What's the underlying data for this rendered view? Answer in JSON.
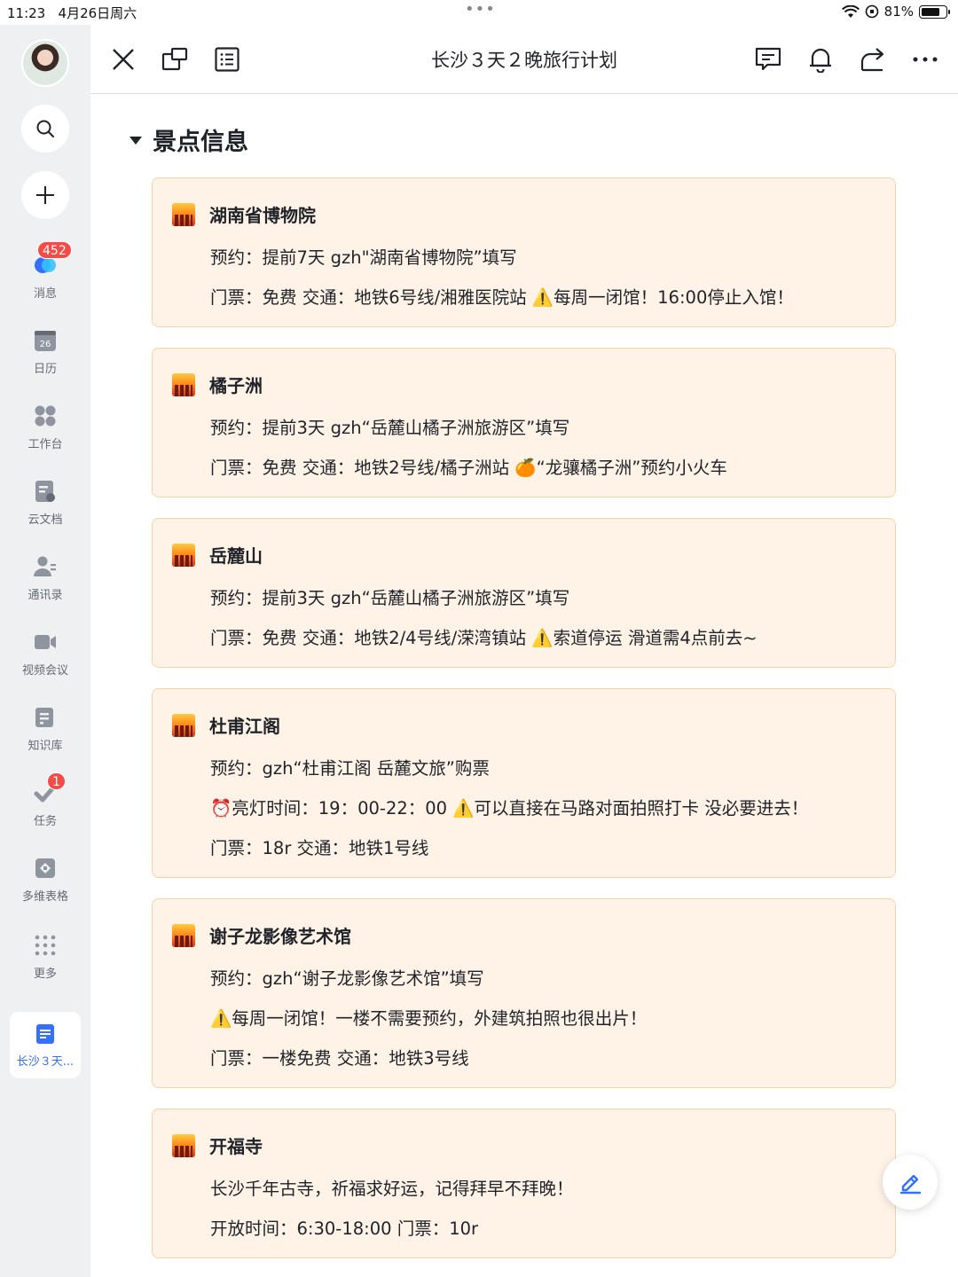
{
  "status_bar": {
    "time": "11:23",
    "date": "4月26日周六",
    "dots": "•••",
    "battery": "81%",
    "battery_level": 0.81
  },
  "sidebar": {
    "message_badge": "452",
    "task_badge": "1",
    "items": [
      {
        "label": "消息",
        "icon": "chat-bubble-icon"
      },
      {
        "label": "日历",
        "icon": "calendar-icon",
        "icon_text": "26"
      },
      {
        "label": "工作台",
        "icon": "grid-apps-icon"
      },
      {
        "label": "云文档",
        "icon": "cloud-doc-icon"
      },
      {
        "label": "通讯录",
        "icon": "contacts-icon"
      },
      {
        "label": "视频会议",
        "icon": "video-camera-icon"
      },
      {
        "label": "知识库",
        "icon": "wiki-book-icon"
      },
      {
        "label": "任务",
        "icon": "task-check-icon"
      },
      {
        "label": "多维表格",
        "icon": "bitable-icon"
      },
      {
        "label": "更多",
        "icon": "more-dots-icon"
      }
    ],
    "current_doc": "长沙３天..."
  },
  "topbar": {
    "title": "长沙３天２晚旅行计划"
  },
  "section": {
    "title": "景点信息"
  },
  "cards": [
    {
      "name": "湖南省博物院",
      "lines": [
        "预约：提前7天  gzh\"湖南省博物院”填写",
        "门票：免费  交通：地铁6号线/湘雅医院站  ⚠️每周一闭馆！16:00停止入馆！"
      ]
    },
    {
      "name": "橘子洲",
      "lines": [
        "预约：提前3天  gzh“岳麓山橘子洲旅游区”填写",
        "门票：免费  交通：地铁2号线/橘子洲站       🍊“龙骧橘子洲”预约小火车"
      ]
    },
    {
      "name": "岳麓山",
      "lines": [
        "预约：提前3天  gzh“岳麓山橘子洲旅游区”填写",
        "门票：免费  交通：地铁2/4号线/溁湾镇站  ⚠️索道停运 滑道需4点前去~"
      ]
    },
    {
      "name": "杜甫江阁",
      "lines": [
        "预约：gzh“杜甫江阁 岳麓文旅”购票",
        "⏰亮灯时间：19：00-22：00 ⚠️可以直接在马路对面拍照打卡 没必要进去！",
        "门票：18r 交通：地铁1号线"
      ]
    },
    {
      "name": "谢子龙影像艺术馆",
      "lines": [
        "预约：gzh“谢子龙影像艺术馆”填写",
        "⚠️每周一闭馆！一楼不需要预约，外建筑拍照也很出片！",
        "门票：一楼免费 交通：地铁3号线"
      ]
    },
    {
      "name": "开福寺",
      "lines": [
        "长沙千年古寺，祈福求好运，记得拜早不拜晚！",
        "开放时间：6:30-18:00 门票：10r"
      ]
    }
  ],
  "colors": {
    "card_bg": "#fef3e6",
    "card_border": "#f8d3a8",
    "accent": "#3370ff",
    "badge": "#f54a45",
    "sidebar_bg": "#eff0f1"
  }
}
